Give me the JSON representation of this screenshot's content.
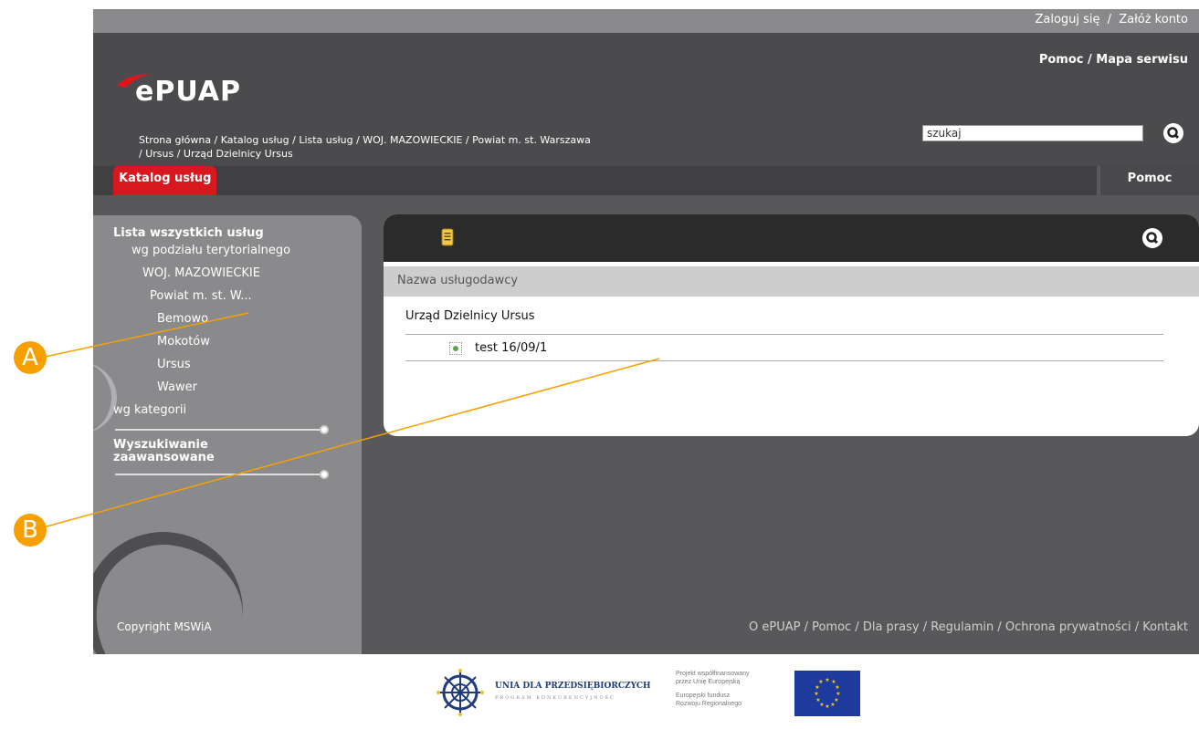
{
  "topbar": {
    "login": "Zaloguj się",
    "register": "Załóż konto",
    "separator": "/"
  },
  "header": {
    "logo_text": "ePUAP",
    "help_map": "Pomoc / Mapa serwisu",
    "breadcrumb_line1": "Strona główna / Katalog usług / Lista usług / WOJ. MAZOWIECKIE / Powiat m. st. Warszawa",
    "breadcrumb_line2": "/ Ursus / Urząd Dzielnicy Ursus",
    "search_placeholder": "szukaj"
  },
  "tabs": {
    "catalog": "Katalog usług",
    "help": "Pomoc"
  },
  "sidebar": {
    "title": "Lista wszystkich usług",
    "by_territory": "wg podziału terytorialnego",
    "voivodeship": "WOJ. MAZOWIECKIE",
    "county": "Powiat m. st. W...",
    "districts": [
      "Bemowo",
      "Mokotów",
      "Ursus",
      "Wawer"
    ],
    "by_category": "wg kategorii",
    "advanced_search_line1": "Wyszukiwanie",
    "advanced_search_line2": "zaawansowane",
    "copyright": "Copyright MSWiA"
  },
  "panel": {
    "column_header": "Nazwa usługodawcy",
    "provider": "Urząd Dzielnicy Ursus",
    "service": "test 16/09/1"
  },
  "footer": {
    "links": "O ePUAP / Pomoc / Dla prasy / Regulamin / Ochrona prywatności / Kontakt",
    "union_title": "UNIA DLA PRZEDSIĘBIORCZYCH",
    "union_sub": "PROGRAM KONKURENCYJNOŚĆ",
    "eu_line1": "Projekt współfinansowany",
    "eu_line2": "przez Unię Europejską",
    "eu_line3": "Europejski fundusz",
    "eu_line4": "Rozwoju Regionalnego"
  },
  "callouts": {
    "a": "A",
    "b": "B"
  },
  "colors": {
    "accent_red": "#d8171f",
    "callout_orange": "#f6a000",
    "header_dark": "#4b4b4d"
  }
}
